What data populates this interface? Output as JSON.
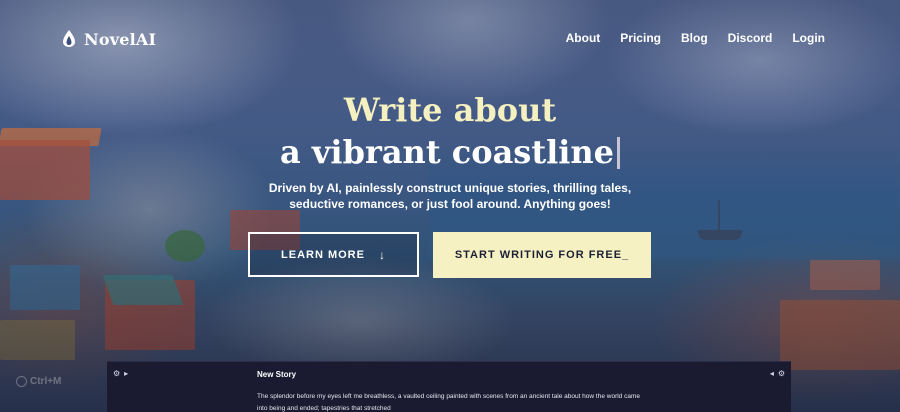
{
  "brand": {
    "name": "NovelAI",
    "logo_icon": "quill-icon"
  },
  "nav": {
    "links": [
      {
        "label": "About"
      },
      {
        "label": "Pricing"
      },
      {
        "label": "Blog"
      },
      {
        "label": "Discord"
      },
      {
        "label": "Login"
      }
    ]
  },
  "hero": {
    "headline_1": "Write about",
    "headline_2": "a vibrant coastline",
    "subtitle_1": "Driven by AI, painlessly construct unique stories, thrilling tales,",
    "subtitle_2": "seductive romances, or just fool around. Anything goes!",
    "learn_more_label": "LEARN MORE",
    "learn_more_icon": "arrow-down-icon",
    "start_label": "START WRITING FOR FREE_"
  },
  "editor_preview": {
    "title": "New Story",
    "text_1": "The splendor before my eyes left me breathless, a vaulted ceiling painted with scenes from an ancient tale about how the world came",
    "text_2": "into being and ended; tapestries that stretched"
  },
  "shortcut_hint": "Ctrl+M",
  "colors": {
    "accent_cream": "#f5f1c2",
    "headline_cream": "#f5f0c0",
    "editor_bg": "#1a1b31",
    "button_text_dark": "#1e1f36"
  }
}
